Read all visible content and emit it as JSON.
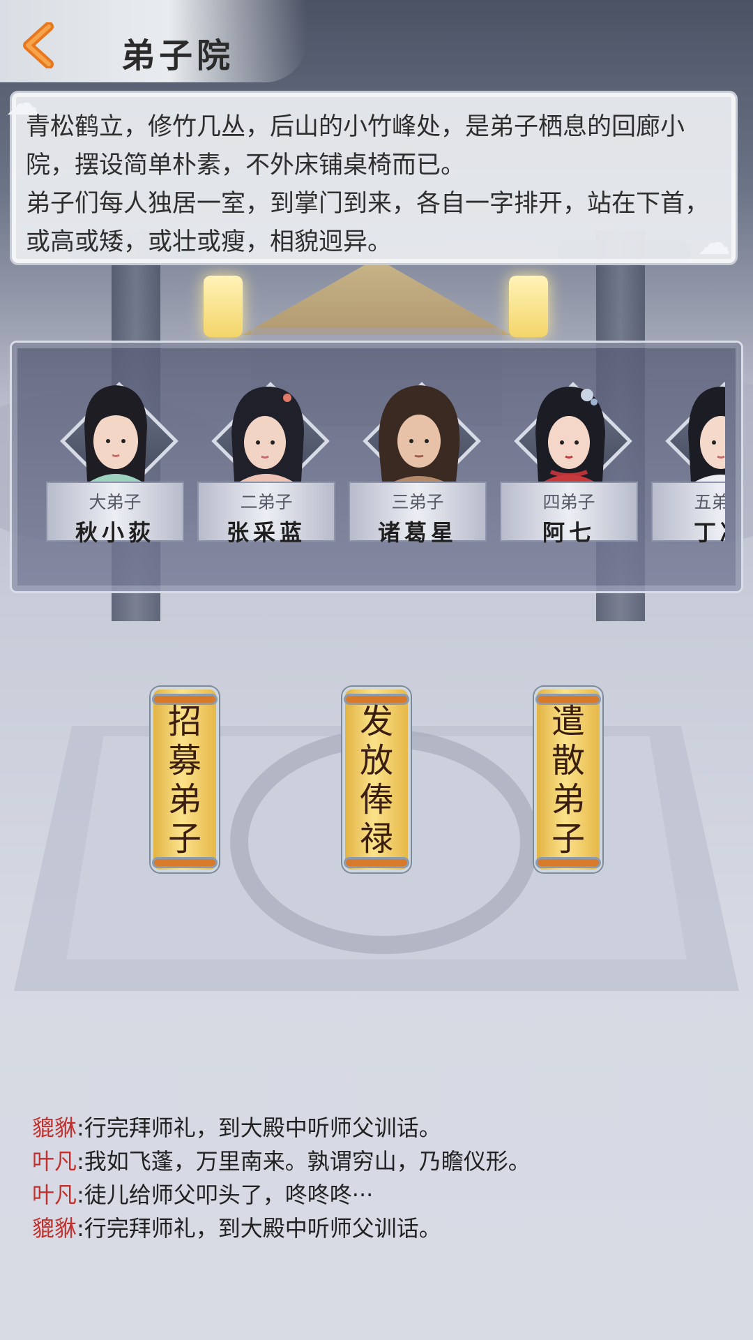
{
  "header": {
    "title": "弟子院",
    "back_icon": "chevron-left-icon"
  },
  "description": {
    "paragraphs": [
      "青松鹤立，修竹几丛，后山的小竹峰处，是弟子栖息的回廊小院，摆设简单朴素，不外床铺桌椅而已。",
      "弟子们每人独居一室，到掌门到来，各自一字排开，站在下首，或高或矮，或壮或瘦，相貌迥异。"
    ]
  },
  "disciples": [
    {
      "rank": "大弟子",
      "name": "秋小荻"
    },
    {
      "rank": "二弟子",
      "name": "张采蓝"
    },
    {
      "rank": "三弟子",
      "name": "诸葛星"
    },
    {
      "rank": "四弟子",
      "name": "阿七"
    },
    {
      "rank": "五弟子",
      "name": "丁凌"
    }
  ],
  "actions": {
    "recruit": "招募弟子",
    "salary": "发放俸禄",
    "dismiss": "遣散弟子"
  },
  "log": [
    {
      "speaker": "貔貅",
      "text": ":行完拜师礼，到大殿中听师父训话。"
    },
    {
      "speaker": "叶凡",
      "text": ":我如飞蓬，万里南来。孰谓穷山，乃瞻仪形。"
    },
    {
      "speaker": "叶凡",
      "text": ":徒儿给师父叩头了，咚咚咚···"
    },
    {
      "speaker": "貔貅",
      "text": ":行完拜师礼，到大殿中听师父训话。"
    }
  ],
  "colors": {
    "speaker": "#c0302c",
    "scroll_gold": "#fbe28a",
    "back_orange": "#e8781f"
  }
}
